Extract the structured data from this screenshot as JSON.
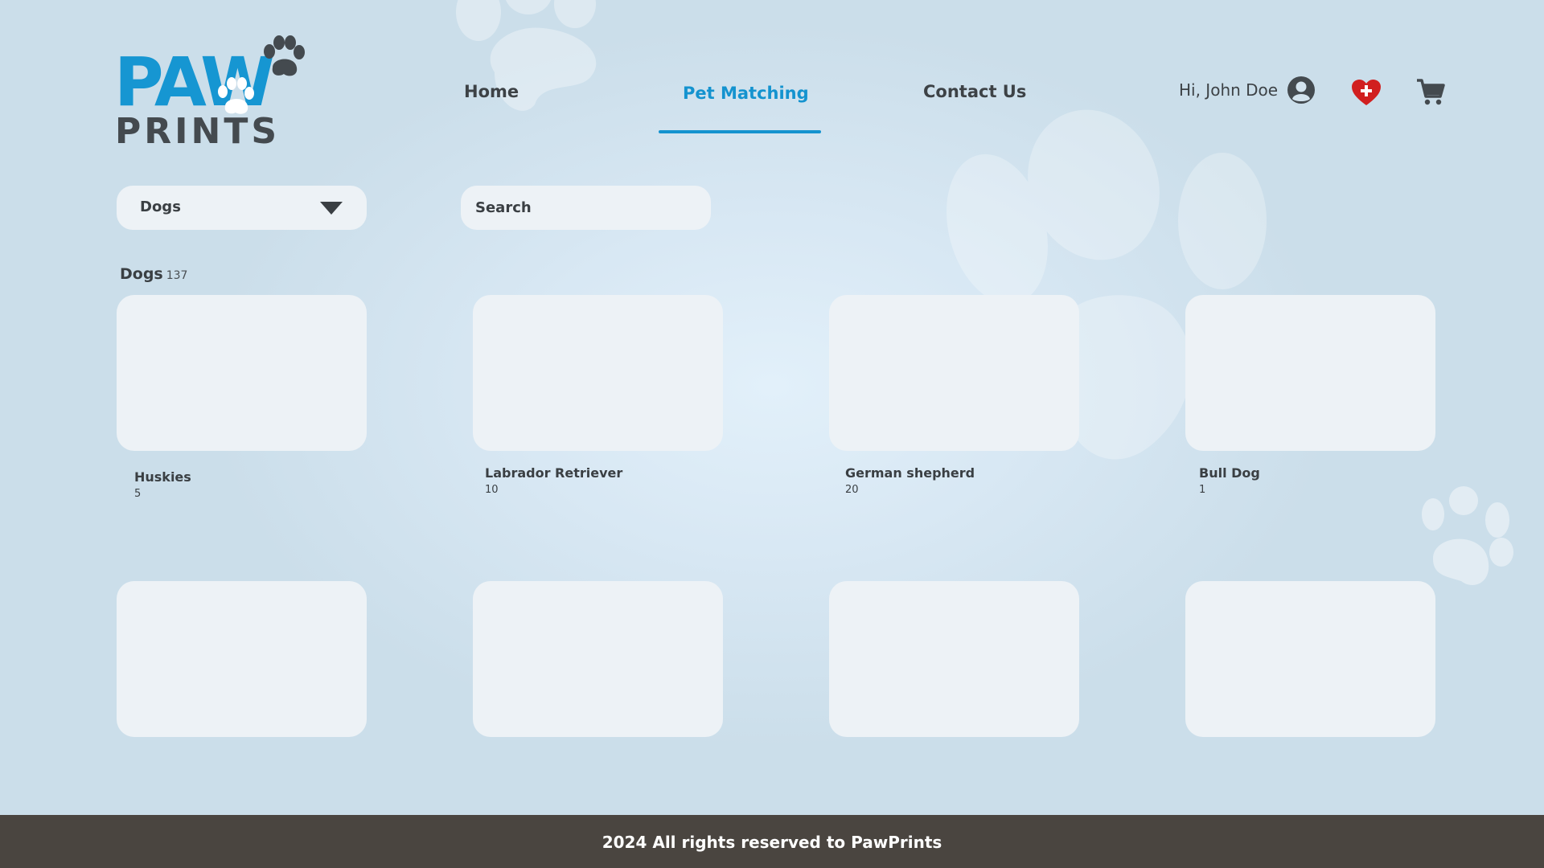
{
  "brand": {
    "logo_top": "PAW",
    "logo_bottom": "PRINTS",
    "accent_color": "#1493cf",
    "text_color": "#3d4246"
  },
  "nav": {
    "items": [
      {
        "label": "Home",
        "active": false
      },
      {
        "label": "Pet Matching",
        "active": true
      },
      {
        "label": "Contact Us",
        "active": false
      }
    ]
  },
  "user": {
    "greeting": "Hi, John Doe",
    "icons": [
      "user-account-icon",
      "favorites-heart-icon",
      "cart-icon"
    ]
  },
  "filters": {
    "category": {
      "selected": "Dogs"
    },
    "search": {
      "placeholder": "Search",
      "value": ""
    }
  },
  "section": {
    "title": "Dogs",
    "count": "137"
  },
  "cards": [
    {
      "name": "Huskies",
      "count": "5"
    },
    {
      "name": "Labrador Retriever",
      "count": "10"
    },
    {
      "name": "German shepherd",
      "count": "20"
    },
    {
      "name": "Bull Dog",
      "count": "1"
    },
    {
      "name": "",
      "count": ""
    },
    {
      "name": "",
      "count": ""
    },
    {
      "name": "",
      "count": ""
    },
    {
      "name": "",
      "count": ""
    }
  ],
  "footer": {
    "text": "2024 All rights reserved to PawPrints"
  }
}
